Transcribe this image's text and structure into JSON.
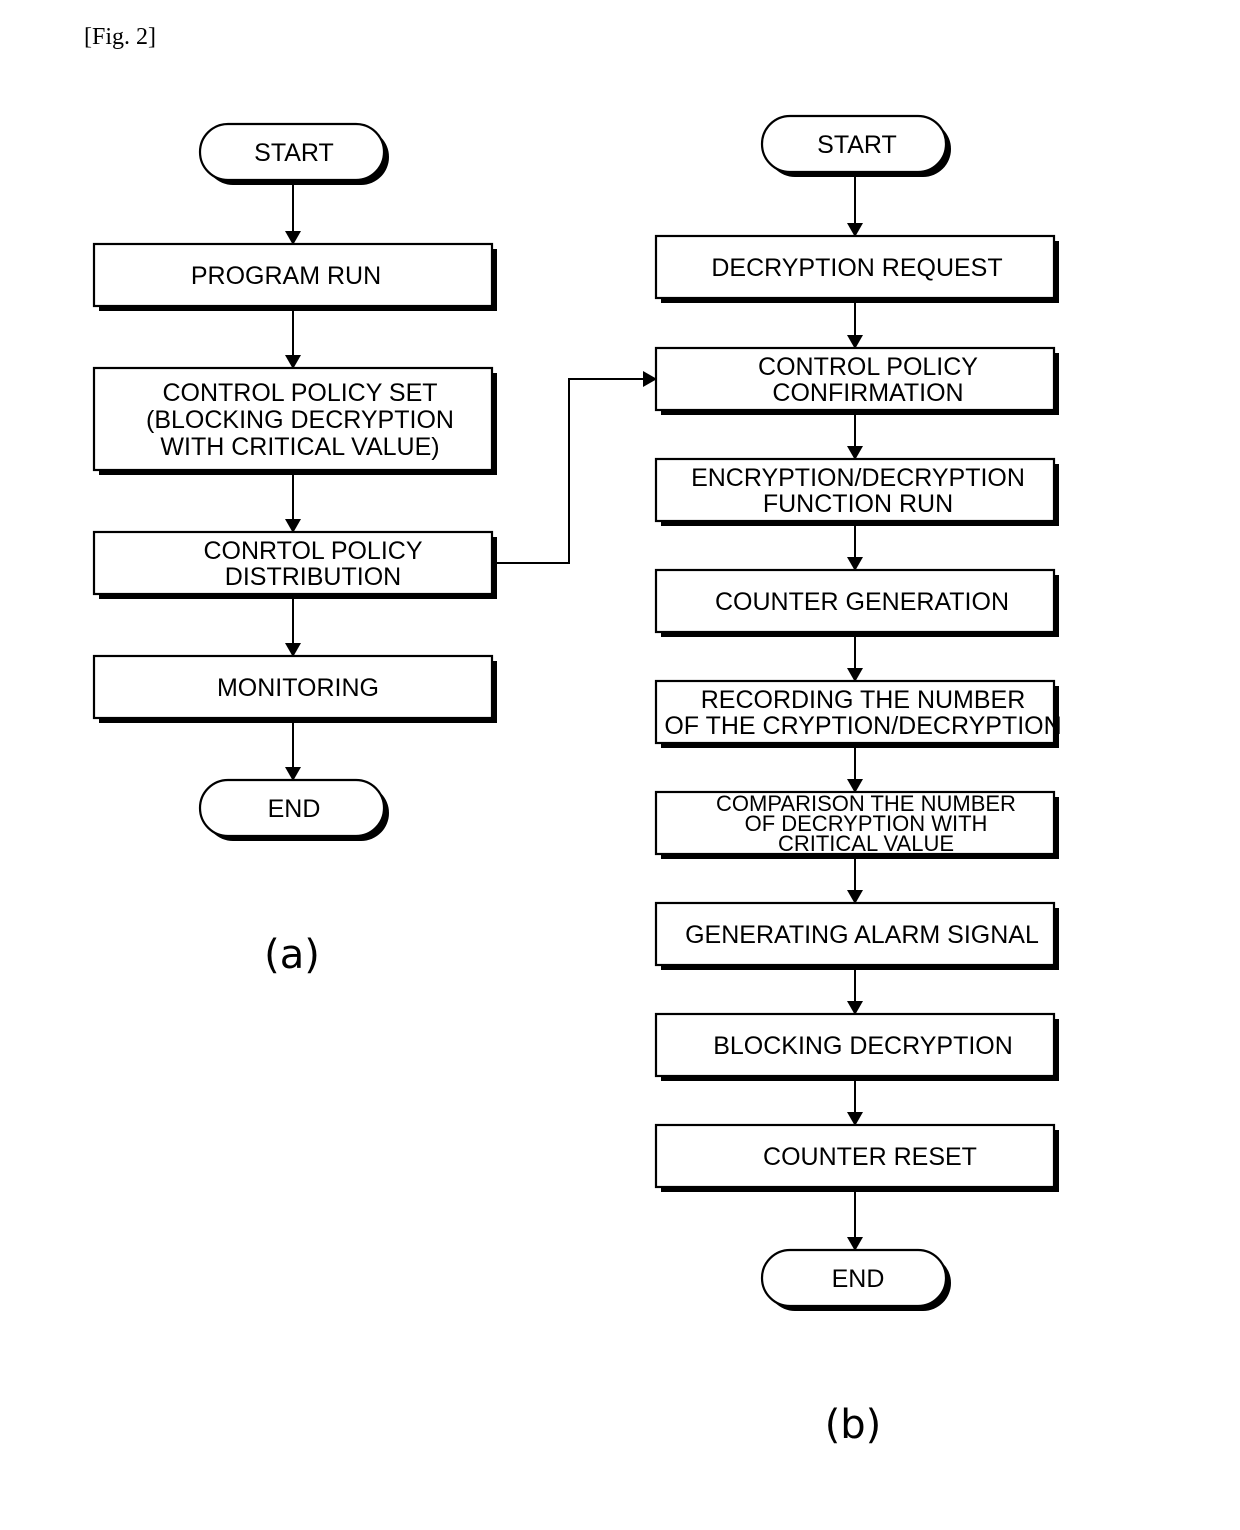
{
  "figure_label": "[Fig. 2]",
  "colors": {
    "ink": "#000000",
    "paper": "#ffffff"
  },
  "flowcharts": [
    {
      "id": "a",
      "caption": "(a)",
      "nodes": [
        {
          "id": "a-start",
          "shape": "terminal",
          "lines": [
            "START"
          ]
        },
        {
          "id": "a-program-run",
          "shape": "process",
          "lines": [
            "PROGRAM RUN"
          ]
        },
        {
          "id": "a-control-policy-set",
          "shape": "process",
          "lines": [
            "CONTROL POLICY SET",
            "(BLOCKING DECRYPTION",
            "WITH CRITICAL VALUE)"
          ]
        },
        {
          "id": "a-control-policy-distribution",
          "shape": "process",
          "lines": [
            "CONRTOL POLICY",
            "DISTRIBUTION"
          ]
        },
        {
          "id": "a-monitoring",
          "shape": "process",
          "lines": [
            "MONITORING"
          ]
        },
        {
          "id": "a-end",
          "shape": "terminal",
          "lines": [
            "END"
          ]
        }
      ]
    },
    {
      "id": "b",
      "caption": "(b)",
      "nodes": [
        {
          "id": "b-start",
          "shape": "terminal",
          "lines": [
            "START"
          ]
        },
        {
          "id": "b-decryption-request",
          "shape": "process",
          "lines": [
            "DECRYPTION REQUEST"
          ]
        },
        {
          "id": "b-control-policy-confirmation",
          "shape": "process",
          "lines": [
            "CONTROL POLICY",
            "CONFIRMATION"
          ]
        },
        {
          "id": "b-enc-dec-function-run",
          "shape": "process",
          "lines": [
            "ENCRYPTION/DECRYPTION",
            "FUNCTION RUN"
          ]
        },
        {
          "id": "b-counter-generation",
          "shape": "process",
          "lines": [
            "COUNTER GENERATION"
          ]
        },
        {
          "id": "b-recording-number",
          "shape": "process",
          "lines": [
            "RECORDING THE NUMBER",
            "OF THE CRYPTION/DECRYPTION"
          ]
        },
        {
          "id": "b-comparison",
          "shape": "process",
          "lines": [
            "COMPARISON THE NUMBER",
            "OF DECRYPTION WITH",
            "CRITICAL VALUE"
          ]
        },
        {
          "id": "b-generating-alarm",
          "shape": "process",
          "lines": [
            "GENERATING ALARM SIGNAL"
          ]
        },
        {
          "id": "b-blocking-decryption",
          "shape": "process",
          "lines": [
            "BLOCKING DECRYPTION"
          ]
        },
        {
          "id": "b-counter-reset",
          "shape": "process",
          "lines": [
            "COUNTER RESET"
          ]
        },
        {
          "id": "b-end",
          "shape": "terminal",
          "lines": [
            "END"
          ]
        }
      ]
    }
  ],
  "edges": [
    {
      "from": "a-start",
      "to": "a-program-run"
    },
    {
      "from": "a-program-run",
      "to": "a-control-policy-set"
    },
    {
      "from": "a-control-policy-set",
      "to": "a-control-policy-distribution"
    },
    {
      "from": "a-control-policy-distribution",
      "to": "a-monitoring"
    },
    {
      "from": "a-monitoring",
      "to": "a-end"
    },
    {
      "from": "a-control-policy-distribution",
      "to": "b-control-policy-confirmation",
      "routing": "elbow"
    },
    {
      "from": "b-start",
      "to": "b-decryption-request"
    },
    {
      "from": "b-decryption-request",
      "to": "b-control-policy-confirmation"
    },
    {
      "from": "b-control-policy-confirmation",
      "to": "b-enc-dec-function-run"
    },
    {
      "from": "b-enc-dec-function-run",
      "to": "b-counter-generation"
    },
    {
      "from": "b-counter-generation",
      "to": "b-recording-number"
    },
    {
      "from": "b-recording-number",
      "to": "b-comparison"
    },
    {
      "from": "b-comparison",
      "to": "b-generating-alarm"
    },
    {
      "from": "b-generating-alarm",
      "to": "b-blocking-decryption"
    },
    {
      "from": "b-blocking-decryption",
      "to": "b-counter-reset"
    },
    {
      "from": "b-counter-reset",
      "to": "b-end"
    }
  ]
}
